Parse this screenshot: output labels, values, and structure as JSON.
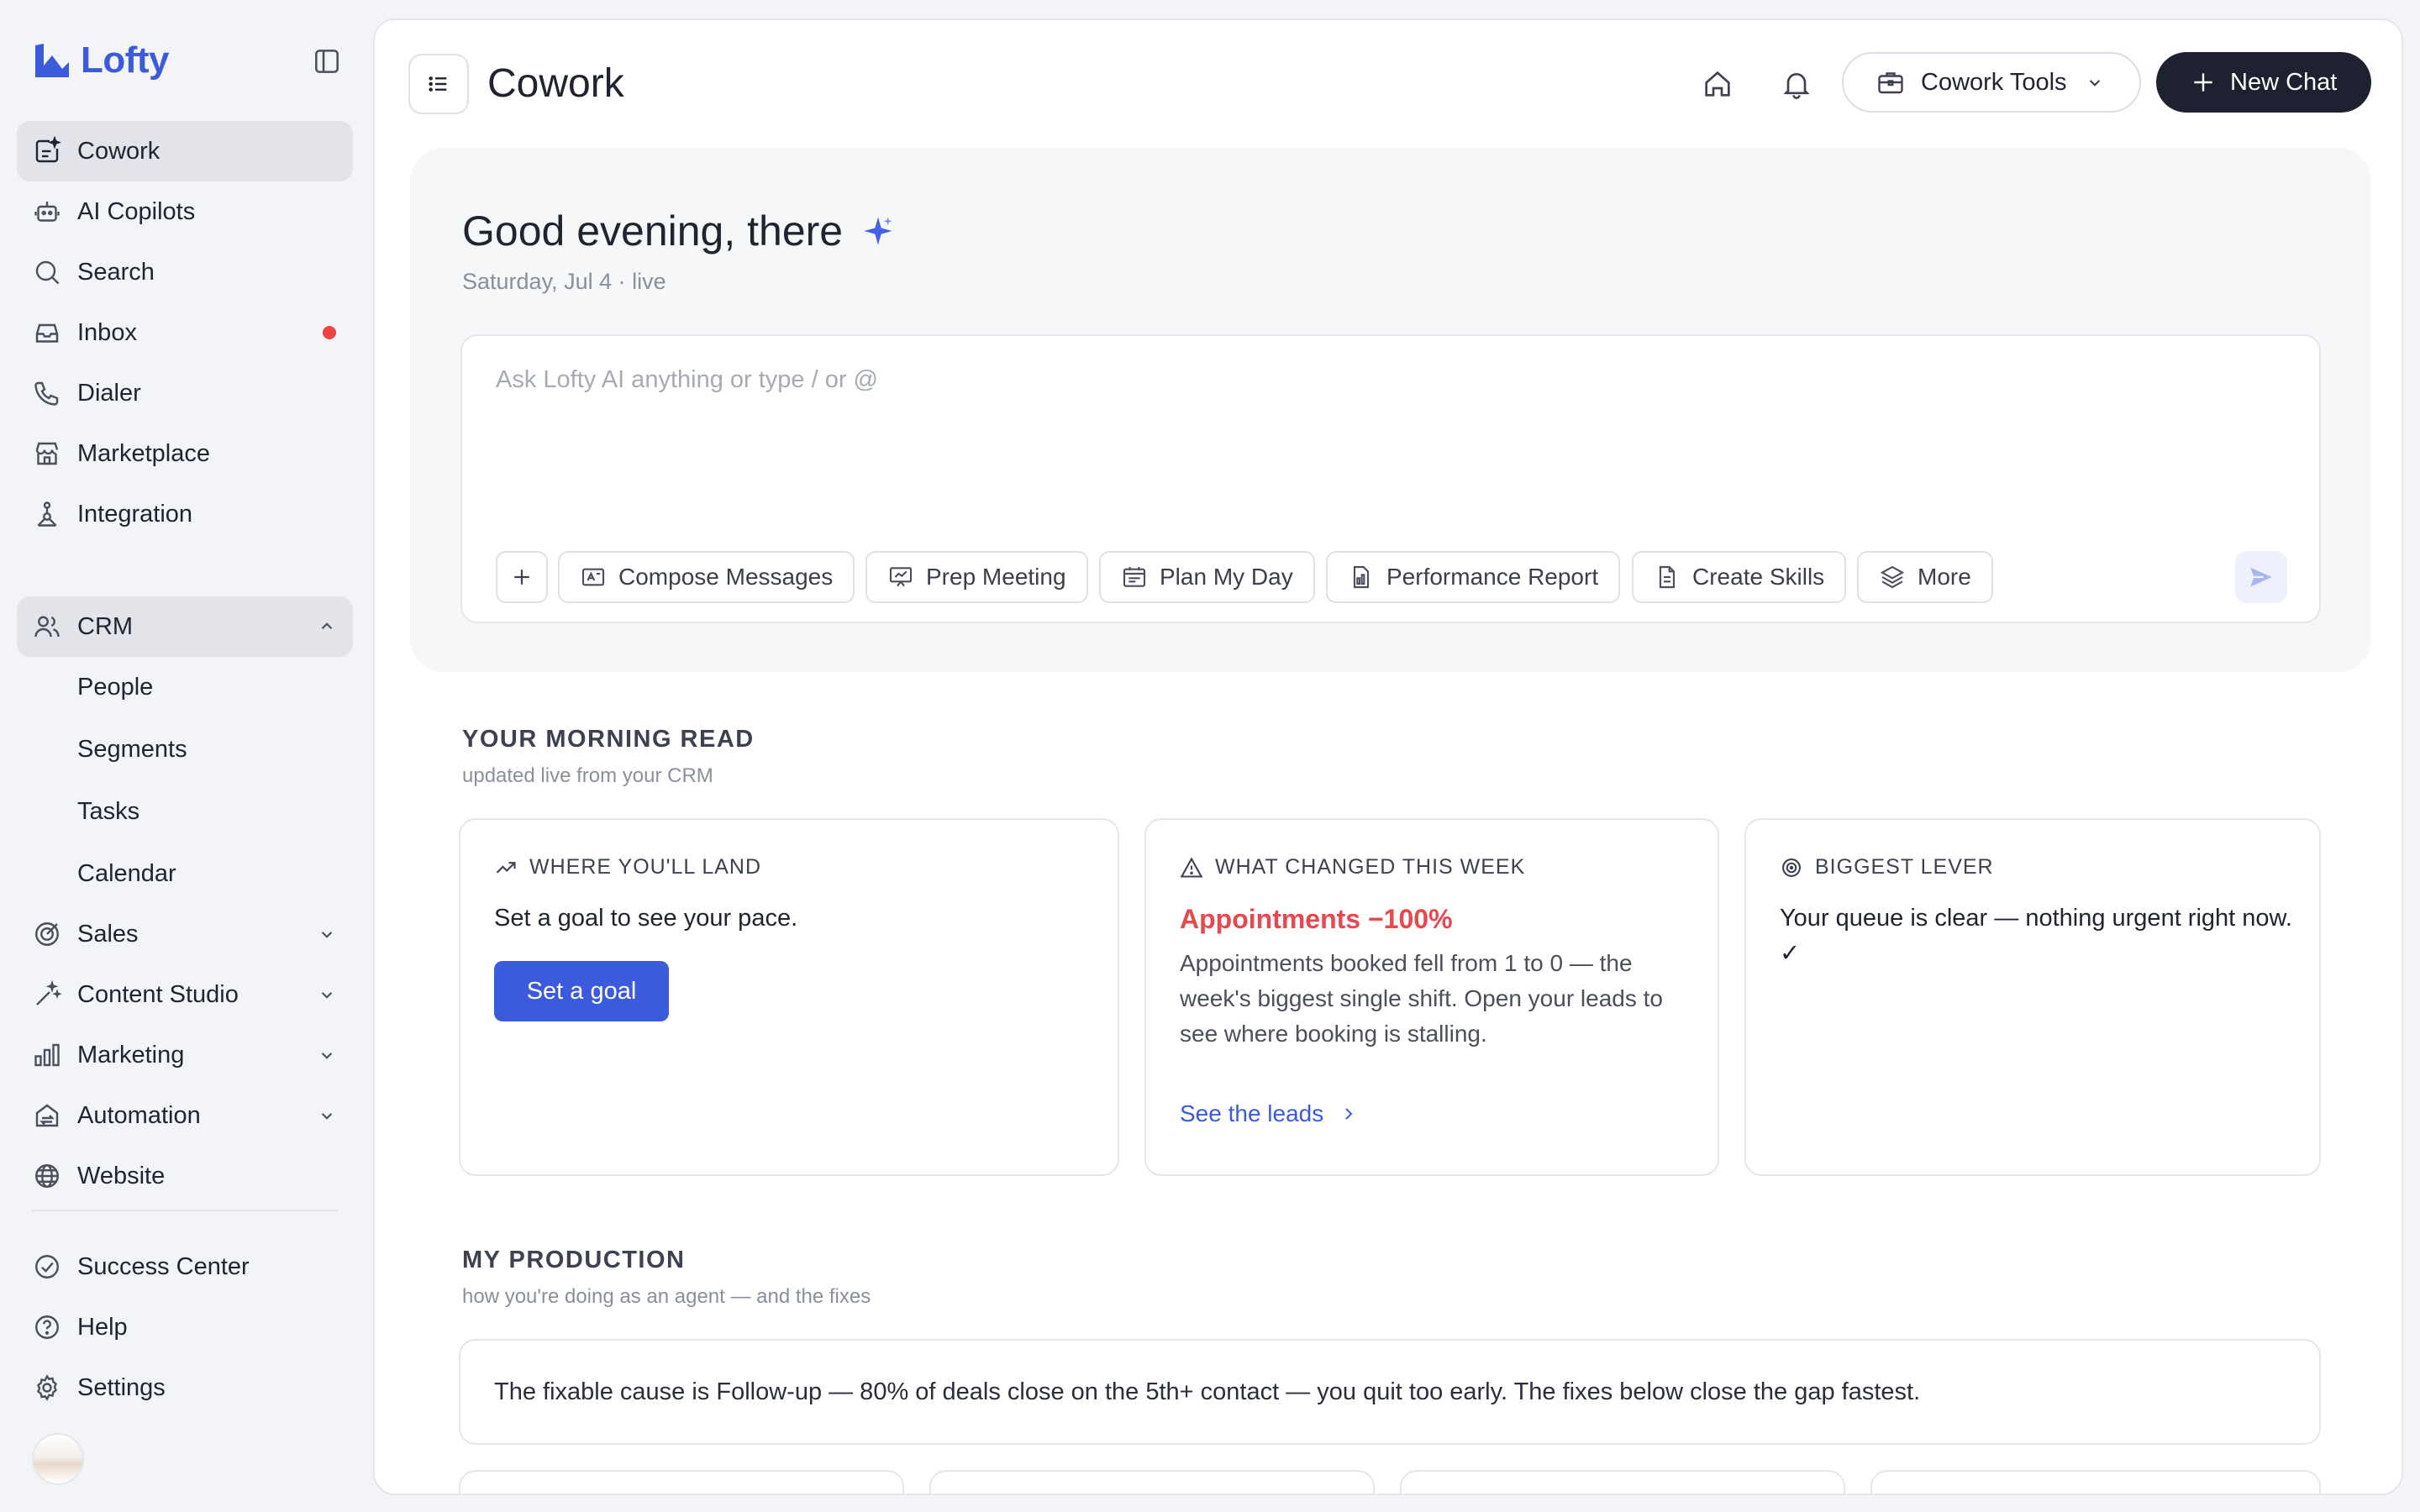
{
  "brand": {
    "name": "Lofty"
  },
  "sidebar": {
    "items": [
      {
        "label": "Cowork",
        "icon": "cowork-icon"
      },
      {
        "label": "AI Copilots",
        "icon": "robot-icon"
      },
      {
        "label": "Search",
        "icon": "search-icon"
      },
      {
        "label": "Inbox",
        "icon": "inbox-icon"
      },
      {
        "label": "Dialer",
        "icon": "phone-icon"
      },
      {
        "label": "Marketplace",
        "icon": "store-icon"
      },
      {
        "label": "Integration",
        "icon": "integration-icon"
      }
    ],
    "crm": {
      "label": "CRM",
      "children": [
        "People",
        "Segments",
        "Tasks",
        "Calendar"
      ]
    },
    "groups": [
      {
        "label": "Sales"
      },
      {
        "label": "Content Studio"
      },
      {
        "label": "Marketing"
      },
      {
        "label": "Automation"
      },
      {
        "label": "Website"
      }
    ],
    "footer": [
      {
        "label": "Success Center"
      },
      {
        "label": "Help"
      },
      {
        "label": "Settings"
      }
    ]
  },
  "header": {
    "title": "Cowork",
    "tools_label": "Cowork Tools",
    "new_chat_label": "New Chat"
  },
  "hero": {
    "greeting": "Good evening, there",
    "date_line": "Saturday, Jul 4 · live",
    "placeholder": "Ask Lofty AI anything or type / or @",
    "chips": [
      "Compose Messages",
      "Prep Meeting",
      "Plan My Day",
      "Performance Report",
      "Create Skills",
      "More"
    ]
  },
  "morning_read": {
    "title": "YOUR MORNING READ",
    "subtitle": "updated live from your CRM",
    "cards": {
      "land": {
        "heading": "WHERE YOU'LL LAND",
        "text": "Set a goal to see your pace.",
        "button": "Set a goal"
      },
      "changed": {
        "heading": "WHAT CHANGED THIS WEEK",
        "alert": "Appointments −100%",
        "text": "Appointments booked fell from 1 to 0 — the week's biggest single shift. Open your leads to see where booking is stalling.",
        "link": "See the leads"
      },
      "lever": {
        "heading": "BIGGEST LEVER",
        "text": "Your queue is clear — nothing urgent right now. ✓"
      }
    }
  },
  "production": {
    "title": "MY PRODUCTION",
    "subtitle": "how you're doing as an agent — and the fixes",
    "summary": "The fixable cause is Follow-up — 80% of deals close on the 5th+ contact — you quit too early. The fixes below close the gap fastest."
  },
  "colors": {
    "accent": "#3b5bdb",
    "alert": "#e5484d",
    "dark": "#1e2230",
    "badge": "#ef4444"
  }
}
